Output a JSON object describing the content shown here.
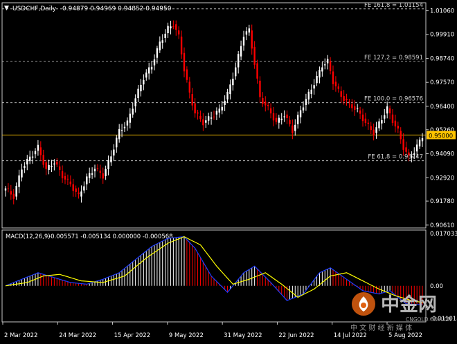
{
  "header": {
    "symbol_label": "USDCHF,Daily",
    "ohlc": "0.94879 0.94969 0.94852 0.94950"
  },
  "chart_data": [
    {
      "type": "candlestick",
      "title": "USDCHF,Daily",
      "ylim": [
        0.9047,
        1.0145
      ],
      "y_ticks": [
        "1.01060",
        "0.99910",
        "0.98740",
        "0.97570",
        "0.96400",
        "0.95260",
        "0.94090",
        "0.92920",
        "0.91780",
        "0.90610"
      ],
      "x_ticks": [
        "2 Mar 2022",
        "24 Mar 2022",
        "15 Apr 2022",
        "9 May 2022",
        "31 May 2022",
        "22 Jun 2022",
        "14 Jul 2022",
        "5 Aug 2022"
      ],
      "current_price_label": "0.95000",
      "horizontal_line": {
        "value": 0.95,
        "color": "#ffc400"
      },
      "levels": [
        {
          "label": "FE 161.8 = 1.01154",
          "value": 1.01154
        },
        {
          "label": "FE 127.2 = 0.98591",
          "value": 0.98591
        },
        {
          "label": "FE 100.0 = 0.96576",
          "value": 0.96576
        },
        {
          "label": "FE 61.8 = 0.93747",
          "value": 0.93747
        }
      ],
      "colors": {
        "up": "#ffffff",
        "down": "#ff0000",
        "grid": "#c8c8c8"
      },
      "anchors": [
        [
          0,
          0.924
        ],
        [
          3,
          0.92
        ],
        [
          6,
          0.934
        ],
        [
          9,
          0.939
        ],
        [
          12,
          0.944
        ],
        [
          15,
          0.933
        ],
        [
          18,
          0.937
        ],
        [
          21,
          0.93
        ],
        [
          24,
          0.926
        ],
        [
          27,
          0.92
        ],
        [
          30,
          0.929
        ],
        [
          33,
          0.934
        ],
        [
          36,
          0.93
        ],
        [
          39,
          0.94
        ],
        [
          42,
          0.952
        ],
        [
          45,
          0.956
        ],
        [
          48,
          0.968
        ],
        [
          51,
          0.978
        ],
        [
          54,
          0.984
        ],
        [
          57,
          0.995
        ],
        [
          60,
          1.002
        ],
        [
          62,
          1.004
        ],
        [
          64,
          0.998
        ],
        [
          66,
          0.982
        ],
        [
          68,
          0.97
        ],
        [
          70,
          0.961
        ],
        [
          73,
          0.956
        ],
        [
          76,
          0.959
        ],
        [
          79,
          0.962
        ],
        [
          82,
          0.97
        ],
        [
          85,
          0.983
        ],
        [
          88,
          0.999
        ],
        [
          90,
          1.001
        ],
        [
          92,
          0.985
        ],
        [
          94,
          0.968
        ],
        [
          97,
          0.963
        ],
        [
          100,
          0.956
        ],
        [
          103,
          0.96
        ],
        [
          106,
          0.952
        ],
        [
          109,
          0.962
        ],
        [
          112,
          0.97
        ],
        [
          115,
          0.978
        ],
        [
          117,
          0.984
        ],
        [
          119,
          0.986
        ],
        [
          121,
          0.976
        ],
        [
          124,
          0.969
        ],
        [
          127,
          0.965
        ],
        [
          130,
          0.962
        ],
        [
          133,
          0.956
        ],
        [
          136,
          0.951
        ],
        [
          139,
          0.958
        ],
        [
          141,
          0.963
        ],
        [
          143,
          0.957
        ],
        [
          145,
          0.952
        ],
        [
          147,
          0.944
        ],
        [
          149,
          0.939
        ],
        [
          151,
          0.942
        ],
        [
          153,
          0.947
        ],
        [
          154,
          0.9495
        ]
      ]
    },
    {
      "type": "macd",
      "title": "MACD(12,26,9)",
      "values_label": "-0.005571 -0.005134 0.000000 -0.000568",
      "ylim": [
        -0.011018,
        0.017033
      ],
      "y_ticks": [
        "0.017033",
        "0.00",
        "-0.011018"
      ],
      "series": [
        {
          "name": "MACD(12,26,9)",
          "color": "#ffffff",
          "style": "histogram"
        },
        {
          "name": "Signal",
          "color": "#ffff00",
          "style": "line"
        },
        {
          "name": "Main",
          "color": "#1e3cff",
          "style": "line"
        }
      ],
      "main_anchors": [
        [
          0,
          0.0
        ],
        [
          6,
          0.002
        ],
        [
          12,
          0.004
        ],
        [
          18,
          0.0025
        ],
        [
          24,
          0.001
        ],
        [
          30,
          0.0005
        ],
        [
          36,
          0.002
        ],
        [
          42,
          0.004
        ],
        [
          48,
          0.008
        ],
        [
          54,
          0.012
        ],
        [
          60,
          0.0145
        ],
        [
          66,
          0.015
        ],
        [
          70,
          0.0115
        ],
        [
          76,
          0.003
        ],
        [
          82,
          -0.002
        ],
        [
          88,
          0.004
        ],
        [
          92,
          0.006
        ],
        [
          98,
          0.001
        ],
        [
          104,
          -0.0045
        ],
        [
          110,
          -0.0025
        ],
        [
          116,
          0.004
        ],
        [
          120,
          0.0055
        ],
        [
          126,
          0.002
        ],
        [
          132,
          -0.0015
        ],
        [
          138,
          -0.0025
        ],
        [
          142,
          -0.0015
        ],
        [
          148,
          -0.0055
        ],
        [
          154,
          -0.0058
        ]
      ],
      "signal_anchors": [
        [
          0,
          0.0
        ],
        [
          8,
          0.001
        ],
        [
          14,
          0.003
        ],
        [
          20,
          0.0035
        ],
        [
          28,
          0.0015
        ],
        [
          36,
          0.001
        ],
        [
          44,
          0.003
        ],
        [
          52,
          0.0085
        ],
        [
          60,
          0.013
        ],
        [
          66,
          0.015
        ],
        [
          72,
          0.0125
        ],
        [
          78,
          0.006
        ],
        [
          84,
          0.0005
        ],
        [
          90,
          0.002
        ],
        [
          96,
          0.004
        ],
        [
          102,
          0.0005
        ],
        [
          108,
          -0.0035
        ],
        [
          114,
          -0.001
        ],
        [
          120,
          0.003
        ],
        [
          126,
          0.004
        ],
        [
          132,
          0.0015
        ],
        [
          138,
          -0.001
        ],
        [
          144,
          -0.003
        ],
        [
          150,
          -0.0045
        ],
        [
          154,
          -0.0051
        ]
      ]
    }
  ],
  "watermark": {
    "brand": "中金网",
    "url": "CNGOLD.COM.CN",
    "slogan": "中 文 财 经 新 媒 体"
  }
}
